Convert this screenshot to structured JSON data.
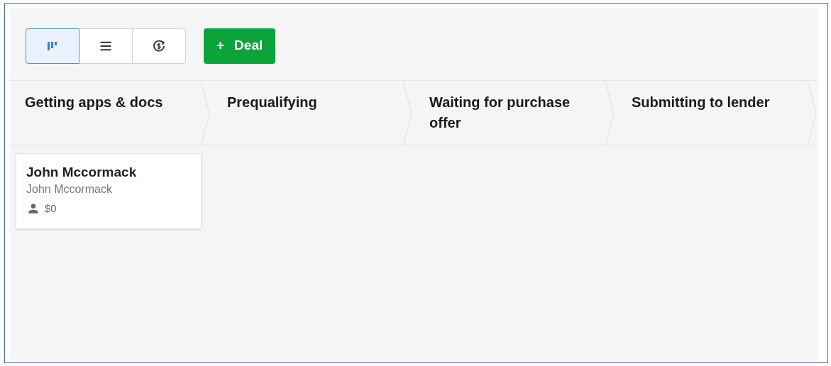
{
  "view_switcher": [
    {
      "kind": "pipeline",
      "selected": true
    },
    {
      "kind": "list",
      "selected": false
    },
    {
      "kind": "forecast",
      "selected": false
    }
  ],
  "add_button": {
    "icon": "+",
    "label": "Deal"
  },
  "stages": [
    {
      "title": "Getting apps & docs",
      "cards": [
        {
          "title": "John Mccormack",
          "person": "John Mccormack",
          "value": "$0"
        }
      ]
    },
    {
      "title": "Prequalifying"
    },
    {
      "title": "Waiting for purchase offer"
    },
    {
      "title": "Submitting to lender"
    }
  ]
}
